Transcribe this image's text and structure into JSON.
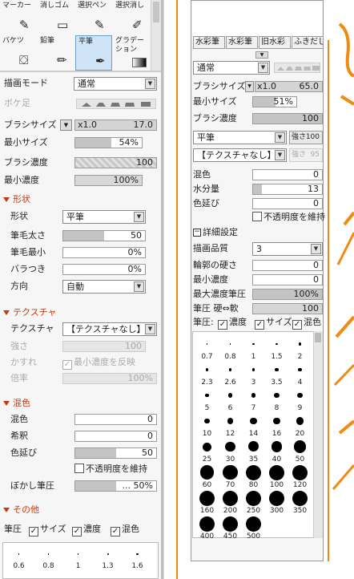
{
  "left": {
    "tools": [
      {
        "label": "マーカー",
        "icon": "marker-icon"
      },
      {
        "label": "消しゴム",
        "icon": "eraser-icon"
      },
      {
        "label": "選択ペン",
        "icon": "select-pen-icon"
      },
      {
        "label": "選択消し",
        "icon": "select-erase-icon"
      },
      {
        "label": "バケツ",
        "icon": "bucket-icon"
      },
      {
        "label": "鉛筆",
        "icon": "pencil-icon"
      },
      {
        "label": "平筆",
        "icon": "flat-brush-icon"
      },
      {
        "label": "グラデーション",
        "icon": "gradient-icon"
      }
    ],
    "draw_mode_label": "描画モード",
    "draw_mode_value": "通常",
    "blur_label": "ボケ足",
    "brush_size_label": "ブラシサイズ",
    "brush_size_mult": "x1.0",
    "brush_size_value": "17.0",
    "min_size_label": "最小サイズ",
    "min_size_value": "54%",
    "min_size_fill": 0.54,
    "density_label": "ブラシ濃度",
    "density_value": "100",
    "min_density_label": "最小濃度",
    "min_density_value": "100%",
    "shape_header": "形状",
    "shape_label": "形状",
    "shape_value": "平筆",
    "bristle_thick_label": "筆毛太さ",
    "bristle_thick_value": "50",
    "bristle_thick_fill": 0.5,
    "bristle_min_label": "筆毛最小",
    "bristle_min_value": "0%",
    "scatter_label": "バラつき",
    "scatter_value": "0%",
    "direction_label": "方向",
    "direction_value": "自動",
    "texture_header": "テクスチャ",
    "texture_label": "テクスチャ",
    "texture_value": "【テクスチャなし】",
    "strength_label": "強さ",
    "strength_value": "100",
    "blur2_label": "かすれ",
    "blur2_check": "最小濃度を反映",
    "scale_label": "倍率",
    "scale_value": "100%",
    "mix_header": "混色",
    "mix_label": "混色",
    "mix_value": "0",
    "dilute_label": "希釈",
    "dilute_value": "0",
    "stretch_label": "色延び",
    "stretch_value": "50",
    "stretch_fill": 0.5,
    "keep_opacity": "不透明度を維持",
    "blur_pressure_label": "ぼかし筆圧",
    "blur_pressure_value": "... 50%",
    "blur_pressure_fill": 0.5,
    "other_header": "その他",
    "pressure_label": "筆圧",
    "pressure_size": "サイズ",
    "pressure_density": "濃度",
    "pressure_mix": "混色",
    "sizes": [
      "0.6",
      "0.8",
      "1",
      "1.3",
      "1.6"
    ]
  },
  "right": {
    "tabs": [
      "水彩筆",
      "水彩筆",
      "旧水彩",
      "ふきだし"
    ],
    "draw_mode_value": "通常",
    "brush_size_label": "ブラシサイズ",
    "brush_size_mult": "x1.0",
    "brush_size_value": "65.0",
    "min_size_label": "最小サイズ",
    "min_size_value": "51%",
    "min_size_fill": 0.51,
    "density_label": "ブラシ濃度",
    "density_value": "100",
    "shape_value": "平筆",
    "shape_strength_label": "強さ",
    "shape_strength_value": "100",
    "texture_value": "【テクスチャなし】",
    "texture_strength_label": "強さ",
    "texture_strength_value": "95",
    "mix_label": "混色",
    "mix_value": "0",
    "water_label": "水分量",
    "water_value": "13",
    "water_fill": 0.13,
    "stretch_label": "色延び",
    "stretch_value": "0",
    "keep_opacity": "不透明度を維持",
    "detail_header": "詳細設定",
    "quality_label": "描画品質",
    "quality_value": "3",
    "edge_label": "輪郭の硬さ",
    "edge_value": "0",
    "min_density_label": "最小濃度",
    "min_density_value": "0",
    "max_pressure_label": "最大濃度筆圧",
    "max_pressure_value": "100%",
    "pressure_hardness_label": "筆圧 硬⇔軟",
    "pressure_hardness_value": "100",
    "pressure_label": "筆圧:",
    "pressure_density": "濃度",
    "pressure_size": "サイズ",
    "pressure_mix": "混色",
    "sizes": [
      "0.7",
      "0.8",
      "1",
      "1.5",
      "2",
      "2.3",
      "2.6",
      "3",
      "3.5",
      "4",
      "5",
      "6",
      "7",
      "8",
      "9",
      "10",
      "12",
      "14",
      "16",
      "20",
      "25",
      "30",
      "35",
      "40",
      "50",
      "60",
      "70",
      "80",
      "100",
      "120",
      "160",
      "200",
      "250",
      "300",
      "350",
      "400",
      "450",
      "500"
    ]
  },
  "colors": {
    "accent": "#c23a12",
    "orange": "#f0900a",
    "selected": "#cfe4f7"
  }
}
